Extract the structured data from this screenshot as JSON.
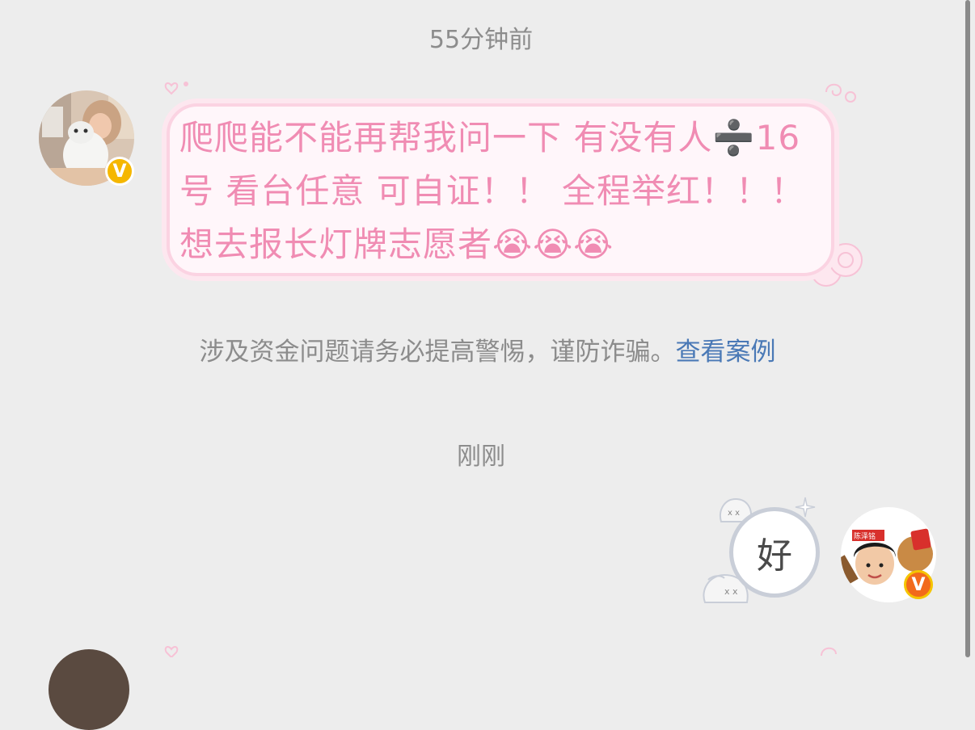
{
  "chat": {
    "timestamp_1": "55分钟前",
    "message_1": {
      "text": "爬爬能不能再帮我问一下 有没有人➗16号 看台任意 可自证！！ 全程举红！！！ 想去报长灯牌志愿者😭😭😭",
      "sender": "other"
    },
    "warning": {
      "text": "涉及资金问题请务必提高警惕，谨防诈骗。",
      "link": "查看案例"
    },
    "timestamp_2": "刚刚",
    "message_2": {
      "text": "好",
      "sender": "me"
    },
    "avatar_other_badge": "V",
    "avatar_me_badge": "V",
    "avatar_me_sticker_text": "陈泽铭"
  },
  "colors": {
    "background": "#ededed",
    "bubble_pink_text": "#f08cb3",
    "link": "#4a79b6",
    "badge_yellow": "#f5b700",
    "badge_orange": "#f26a1b"
  }
}
